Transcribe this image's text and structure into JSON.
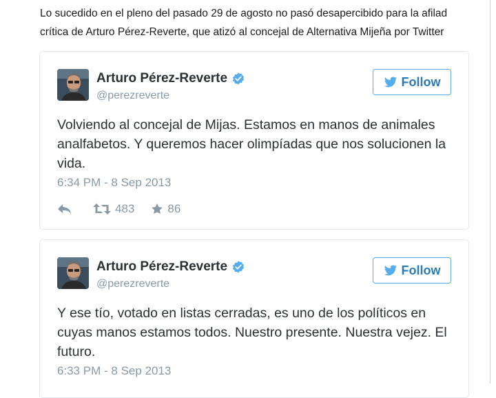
{
  "article": {
    "line1": "Lo sucedido en el pleno del pasado 29 de agosto no pasó desapercibido para la afilad",
    "line2": "crítica de Arturo Pérez-Reverte, que atizó al concejal de Alternativa Mijeña por Twitter"
  },
  "colors": {
    "follow": "#2b7bb9",
    "verified": "#55acee",
    "meta": "#8899a6"
  },
  "tweets": [
    {
      "name": "Arturo Pérez-Reverte",
      "handle": "@perezreverte",
      "follow_label": "Follow",
      "text": "Volviendo al concejal de Mijas. Estamos en manos de animales analfabetos. Y queremos hacer olimpíadas que nos solucionen la vida.",
      "timestamp": "6:34 PM - 8 Sep 2013",
      "retweets": "483",
      "favorites": "86"
    },
    {
      "name": "Arturo Pérez-Reverte",
      "handle": "@perezreverte",
      "follow_label": "Follow",
      "text": "Y ese tío, votado en listas cerradas, es uno de los políticos en cuyas manos estamos todos. Nuestro presente. Nuestra vejez. El futuro.",
      "timestamp": "6:33 PM - 8 Sep 2013"
    }
  ]
}
